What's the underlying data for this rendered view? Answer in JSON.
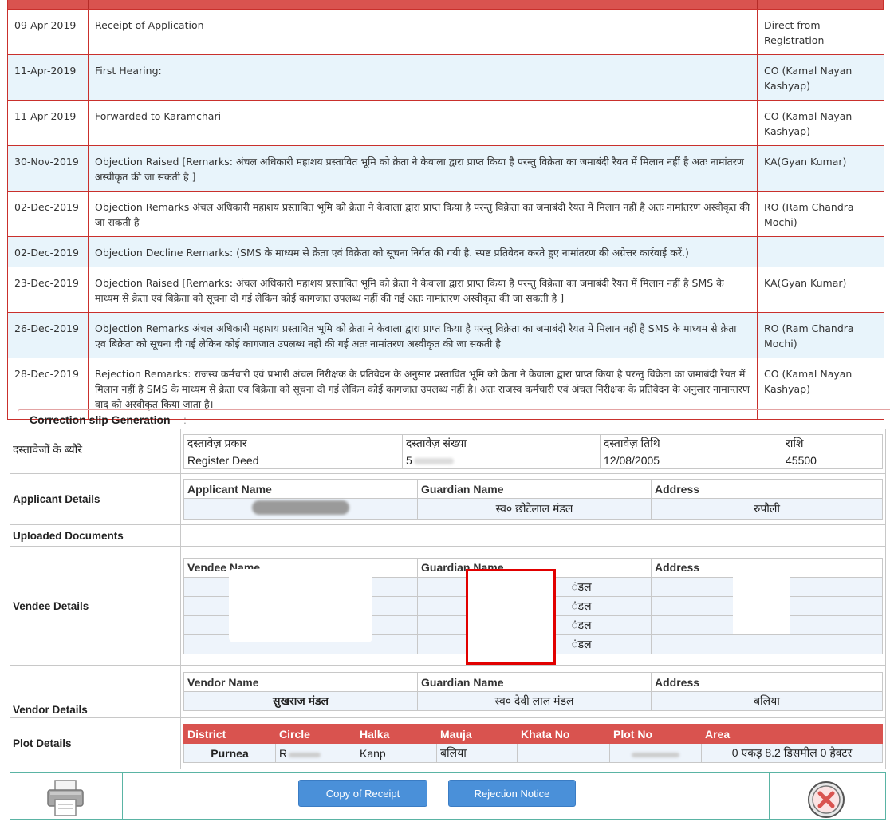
{
  "history": [
    {
      "date": "09-Apr-2019",
      "action": "Receipt of Application",
      "by": "Direct from Registration"
    },
    {
      "date": "11-Apr-2019",
      "action": "First Hearing:",
      "by": "CO (Kamal Nayan Kashyap)"
    },
    {
      "date": "11-Apr-2019",
      "action": "Forwarded to Karamchari",
      "by": "CO (Kamal Nayan Kashyap)"
    },
    {
      "date": "30-Nov-2019",
      "action": "Objection Raised [Remarks: अंचल अधिकारी महाशय प्रस्तावित भूमि को क्रेता ने केवाला द्वारा प्राप्त किया है परन्तु विक्रेता का जमाबंदी रैयत में मिलान नहीं है अतः नामांतरण अस्वीकृत की जा सकती है ]",
      "by": "KA(Gyan Kumar)"
    },
    {
      "date": "02-Dec-2019",
      "action": "Objection Remarks अंचल अधिकारी महाशय प्रस्तावित भूमि को क्रेता ने केवाला द्वारा प्राप्त किया है परन्तु विक्रेता का जमाबंदी रैयत में मिलान नहीं है अतः नामांतरण अस्वीकृत की जा सकती है",
      "by": "RO (Ram Chandra Mochi)"
    },
    {
      "date": "02-Dec-2019",
      "action": "Objection Decline Remarks: (SMS के माध्यम से क्रेता एवं विक्रेता को सूचना निर्गत की गयी है. स्पष्ट प्रतिवेदन करते हुए नामांतरण की अग्रेत्तर कार्रवाई करें.)",
      "by": ""
    },
    {
      "date": "23-Dec-2019",
      "action": "Objection Raised [Remarks: अंचल अधिकारी महाशय प्रस्तावित भूमि को क्रेता ने केवाला द्वारा प्राप्त किया है परन्तु विक्रेता का जमाबंदी रैयत में मिलान नहीं है SMS के माध्यम से क्रेता एवं बिक्रेता को सूचना दी गई लेकिन कोई कागजात उपलब्ध नहीं की गई अतः नामांतरण अस्वीकृत की जा सकती है ]",
      "by": "KA(Gyan Kumar)"
    },
    {
      "date": "26-Dec-2019",
      "action": "Objection Remarks अंचल अधिकारी महाशय प्रस्तावित भूमि को क्रेता ने केवाला द्वारा प्राप्त किया है परन्तु विक्रेता का जमाबंदी रैयत में मिलान नहीं है SMS के माध्यम से क्रेता एव बिक्रेता को सूचना दी गई लेकिन कोई कागजात उपलब्ध नहीं की गई अतः नामांतरण अस्वीकृत की जा सकती है",
      "by": "RO (Ram Chandra Mochi)"
    },
    {
      "date": "28-Dec-2019",
      "action": "Rejection Remarks: राजस्व कर्मचारी एवं प्रभारी अंचल निरीक्षक के प्रतिवेदन के अनुसार प्रस्तावित भूमि को क्रेता ने केवाला द्वारा प्राप्त किया है परन्तु विक्रेता का जमाबंदी रैयत में मिलान नहीं है SMS के माध्यम से क्रेता एव बिक्रेता को सूचना दी गई लेकिन कोई कागजात उपलब्ध नहीं है। अतः राजस्व कर्मचारी एवं अंचल निरीक्षक के प्रतिवेदन के अनुसार नामान्तरण वाद को अस्वीकृत किया जाता है।",
      "by": "CO (Kamal Nayan Kashyap)"
    }
  ],
  "slip": {
    "title": "Correction slip Generation",
    "tab_sep": ":",
    "documents": {
      "label": "दस्तावेजों के ब्यौरे",
      "headers": [
        "दस्तावेज़ प्रकार",
        "दस्तावेज़ संख्या",
        "दस्तावेज़ तिथि",
        "राशि"
      ],
      "row": [
        "Register Deed",
        "5",
        "12/08/2005",
        "45500"
      ]
    },
    "applicant": {
      "label": "Applicant Details",
      "headers": [
        "Applicant Name",
        "Guardian Name",
        "Address"
      ],
      "row": {
        "name": "",
        "guardian": "स्व० छोटेलाल मंडल",
        "address": "रुपौली"
      }
    },
    "uploaded": {
      "label": "Uploaded Documents"
    },
    "vendee": {
      "label": "Vendee Details",
      "headers": [
        "Vendee Name",
        "Guardian Name",
        "Address"
      ],
      "rows": [
        {
          "guardian_tail": "ंडल"
        },
        {
          "guardian_tail": "ंडल"
        },
        {
          "guardian_tail": "ंडल"
        },
        {
          "guardian_tail": "ंडल"
        }
      ]
    },
    "vendor": {
      "label": "Vendor Details",
      "headers": [
        "Vendor Name",
        "Guardian Name",
        "Address"
      ],
      "row": {
        "name": "सुखराज मंडल",
        "guardian": "स्व० देवी लाल मंडल",
        "address": "बलिया"
      }
    },
    "plot": {
      "label": "Plot Details",
      "headers": [
        "District",
        "Circle",
        "Halka",
        "Mauja",
        "Khata No",
        "Plot No",
        "Area"
      ],
      "row": {
        "district": "Purnea",
        "circle": "R",
        "halka": "Kanp",
        "mauja": "बलिया",
        "khata": "",
        "plot": "",
        "area": "0 एकड़ 8.2 डिसमील 0 हेक्टर"
      }
    }
  },
  "actions": {
    "copy_receipt": "Copy of Receipt",
    "rejection_notice": "Rejection Notice"
  },
  "colors": {
    "header_red": "#d9534f",
    "alt_row": "#e8f4fb",
    "button_blue": "#4a90d9",
    "bar_border": "#5ab4a4"
  }
}
